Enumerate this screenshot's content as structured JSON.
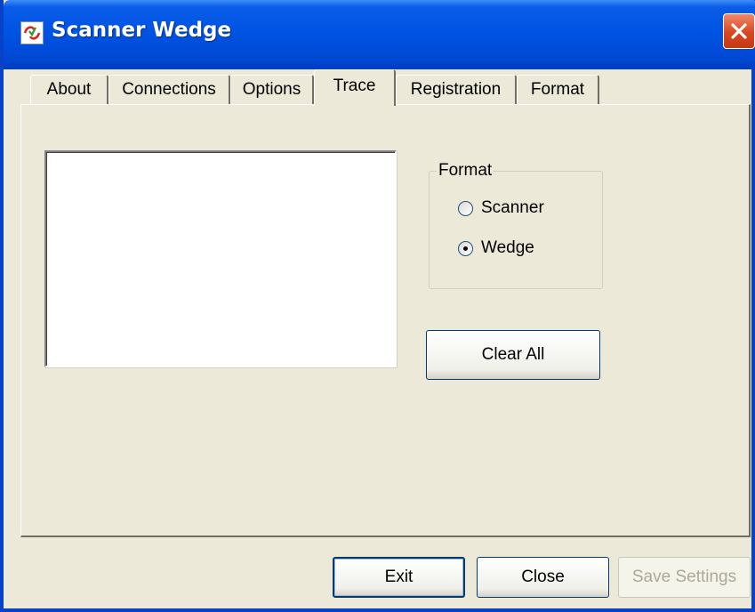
{
  "window": {
    "title": "Scanner Wedge"
  },
  "tabs": [
    {
      "label": "About",
      "active": false
    },
    {
      "label": "Connections",
      "active": false
    },
    {
      "label": "Options",
      "active": false
    },
    {
      "label": "Trace",
      "active": true
    },
    {
      "label": "Registration",
      "active": false
    },
    {
      "label": "Format",
      "active": false
    }
  ],
  "trace": {
    "log_text": ""
  },
  "format_group": {
    "label": "Format",
    "options": [
      {
        "label": "Scanner",
        "checked": false
      },
      {
        "label": "Wedge",
        "checked": true
      }
    ]
  },
  "buttons": {
    "clear_all": "Clear All",
    "exit": "Exit",
    "close": "Close",
    "save_settings": "Save Settings"
  },
  "icons": {
    "app": "scanner-wedge-app-icon",
    "close": "close-icon"
  },
  "colors": {
    "titlebar": "#0054e3",
    "close_button": "#d9461f",
    "face": "#ece9d8"
  }
}
